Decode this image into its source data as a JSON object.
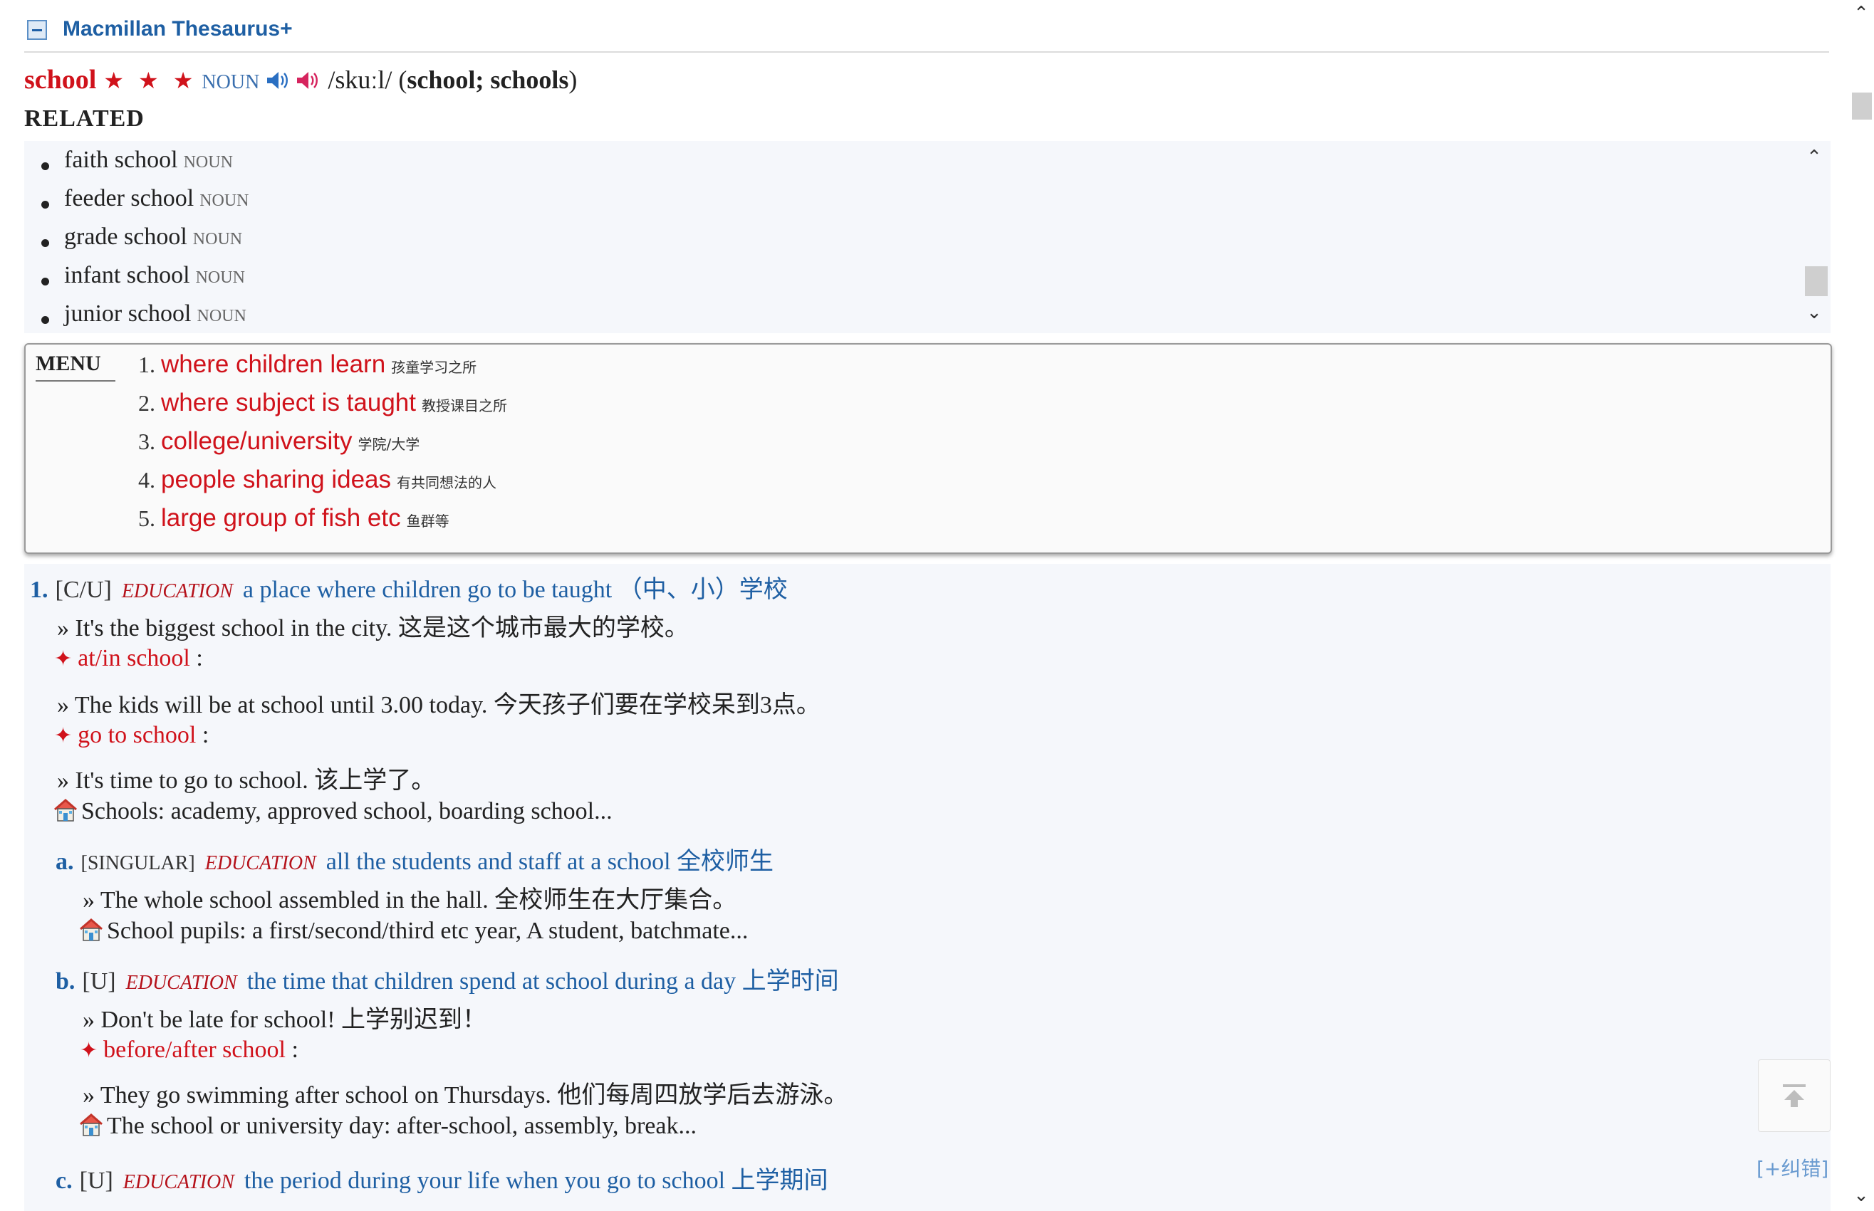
{
  "dictionary": {
    "title": "Macmillan Thesaurus+"
  },
  "entry": {
    "headword": "school",
    "stars": "★ ★ ★",
    "pos": "NOUN",
    "pronunciation": "/skuːl/",
    "forms_open": "(",
    "forms": "school; schools",
    "forms_close": ")"
  },
  "related": {
    "heading": "RELATED",
    "items": [
      {
        "word": "faith school",
        "pos": "NOUN"
      },
      {
        "word": "feeder school",
        "pos": "NOUN"
      },
      {
        "word": "grade school",
        "pos": "NOUN"
      },
      {
        "word": "infant school",
        "pos": "NOUN"
      },
      {
        "word": "junior school",
        "pos": "NOUN"
      }
    ]
  },
  "menu": {
    "label": "MENU",
    "items": [
      {
        "num": "1.",
        "en": "where children learn",
        "zh": "孩童学习之所"
      },
      {
        "num": "2.",
        "en": "where subject is taught",
        "zh": "教授课目之所"
      },
      {
        "num": "3.",
        "en": "college/university",
        "zh": "学院/大学"
      },
      {
        "num": "4.",
        "en": "people sharing ideas",
        "zh": "有共同想法的人"
      },
      {
        "num": "5.",
        "en": "large group of fish etc",
        "zh": "鱼群等"
      }
    ]
  },
  "senses": {
    "s1": {
      "num": "1.",
      "gram": "[C/U]",
      "label": "EDUCATION",
      "def": "a place where children go to be taught （中、小）学校",
      "ex1": "» It's the biggest school in the city. 这是这个城市最大的学校。",
      "phrase1": "at/in school",
      "colon": " :",
      "ex2": "» The kids will be at school until 3.00 today. 今天孩子们要在学校呆到3点。",
      "phrase2": "go to school",
      "ex3": "» It's time to go to school. 该上学了。",
      "thes": "Schools: academy, approved school, boarding school..."
    },
    "sa": {
      "num": "a.",
      "gram": "[SINGULAR]",
      "label": "EDUCATION",
      "def": "all the students and staff at a school 全校师生",
      "ex1": "» The whole school assembled in the hall. 全校师生在大厅集合。",
      "thes": "School pupils: a first/second/third etc year, A student, batchmate..."
    },
    "sb": {
      "num": "b.",
      "gram": "[U]",
      "label": "EDUCATION",
      "def": "the time that children spend at school during a day 上学时间",
      "ex1": "» Don't be late for school! 上学别迟到！",
      "phrase1": "before/after school",
      "ex2": "» They go swimming after school on Thursdays. 他们每周四放学后去游泳。",
      "thes": "The school or university day: after-school, assembly, break..."
    },
    "sc": {
      "num": "c.",
      "gram": "[U]",
      "label": "EDUCATION",
      "def": "the period during your life when you go to school 上学期间"
    }
  },
  "footer": {
    "report": "[+纠错]"
  },
  "colors": {
    "headword": "#d0121b",
    "definition": "#1e5fa3",
    "menu_item": "#d0121b"
  },
  "icons": [
    "minus-icon",
    "speaker-uk-icon",
    "speaker-us-icon",
    "house-icon",
    "chevron-up-icon",
    "chevron-down-icon",
    "back-to-top-icon"
  ]
}
